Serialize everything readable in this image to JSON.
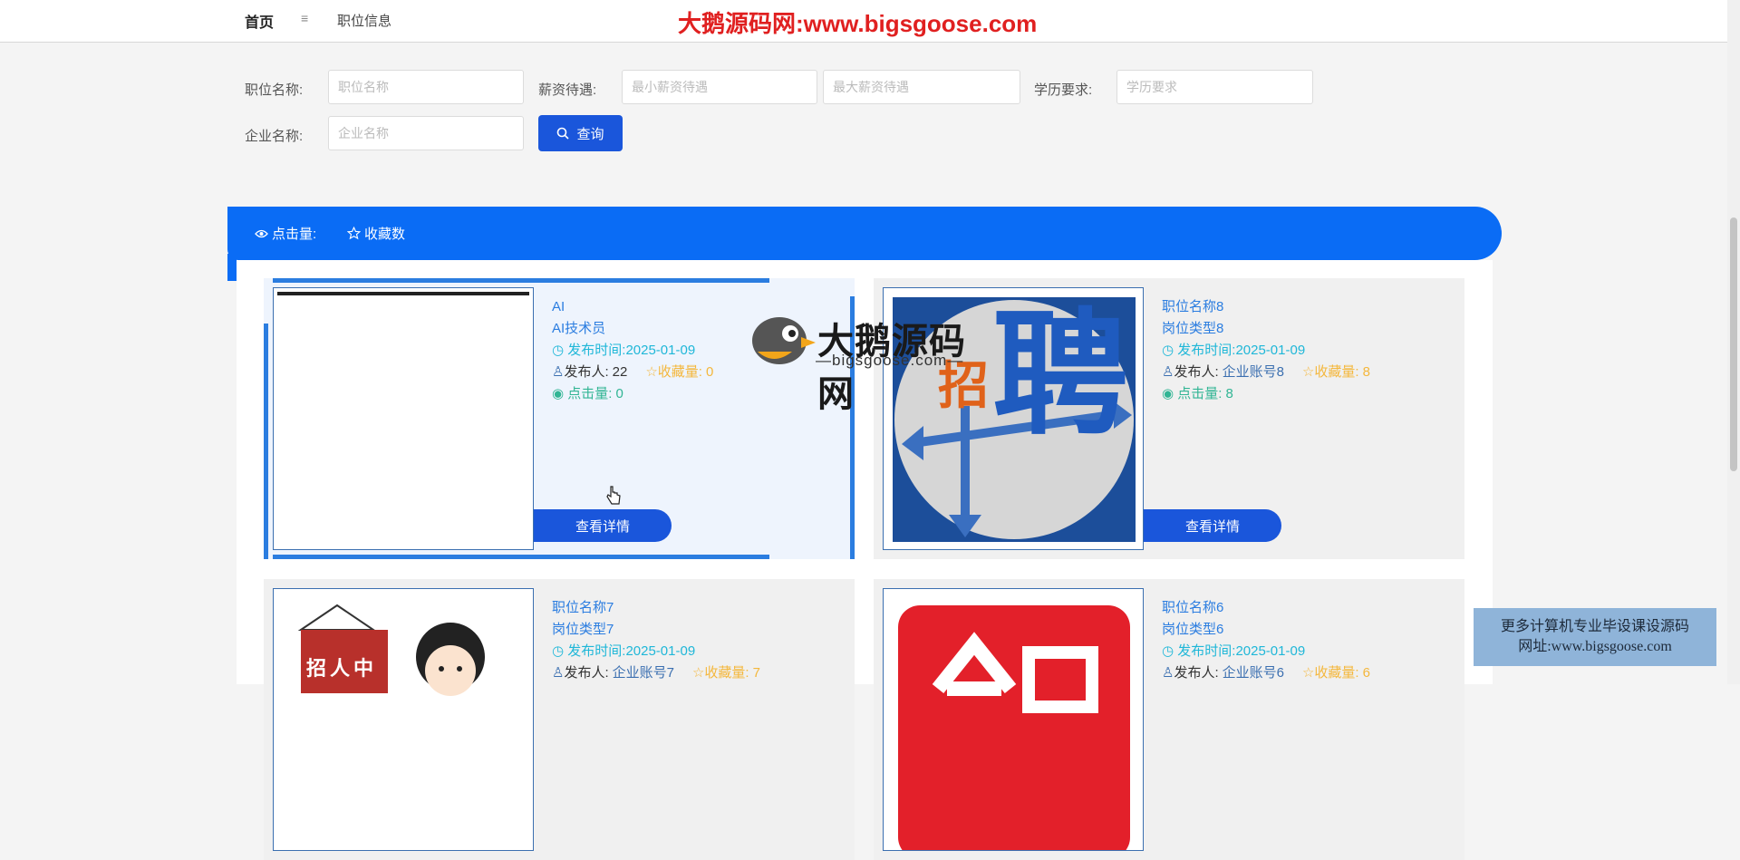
{
  "nav": {
    "home": "首页",
    "separator": "≡",
    "jobs": "职位信息"
  },
  "banner": "大鹅源码网:www.bigsgoose.com",
  "search": {
    "job_name_label": "职位名称:",
    "job_name_placeholder": "职位名称",
    "salary_label": "薪资待遇:",
    "salary_min_placeholder": "最小薪资待遇",
    "salary_max_placeholder": "最大薪资待遇",
    "education_label": "学历要求:",
    "education_placeholder": "学历要求",
    "company_label": "企业名称:",
    "company_placeholder": "企业名称",
    "query_button": "查询",
    "search_icon": "search-icon"
  },
  "sort_bar": {
    "clicks": "点击量:",
    "favorites": "收藏数"
  },
  "cards": [
    {
      "title": "AI",
      "type": "AI技术员",
      "publish_label": "发布时间:",
      "publish_time": "2025-01-09",
      "publisher_label": "发布人:",
      "publisher": "22",
      "fav_label": "收藏量:",
      "fav": "0",
      "clicks_label": "点击量:",
      "clicks": "0",
      "detail": "查看详情"
    },
    {
      "title": "职位名称8",
      "type": "岗位类型8",
      "publish_label": "发布时间:",
      "publish_time": "2025-01-09",
      "publisher_label": "发布人:",
      "publisher": "企业账号8",
      "fav_label": "收藏量:",
      "fav": "8",
      "clicks_label": "点击量:",
      "clicks": "8",
      "detail": "查看详情",
      "image_text": "聘",
      "image_text2": "招"
    },
    {
      "title": "职位名称7",
      "type": "岗位类型7",
      "publish_label": "发布时间:",
      "publish_time": "2025-01-09",
      "publisher_label": "发布人:",
      "publisher": "企业账号7",
      "fav_label": "收藏量:",
      "fav": "7",
      "image_text": "招人中"
    },
    {
      "title": "职位名称6",
      "type": "岗位类型6",
      "publish_label": "发布时间:",
      "publish_time": "2025-01-09",
      "publisher_label": "发布人:",
      "publisher": "企业账号6",
      "fav_label": "收藏量:",
      "fav": "6"
    }
  ],
  "watermark": {
    "title": "大鹅源码网",
    "subtitle": "—bigsgoose.com—"
  },
  "promo": {
    "line1": "更多计算机专业毕设课设源码",
    "line2": "网址:www.bigsgoose.com"
  },
  "colors": {
    "primary": "#1a56db",
    "bar": "#0a6cf5",
    "teal": "#1fb7d8",
    "gold": "#f4b73c",
    "green": "#31b594",
    "banner": "#e02020"
  }
}
